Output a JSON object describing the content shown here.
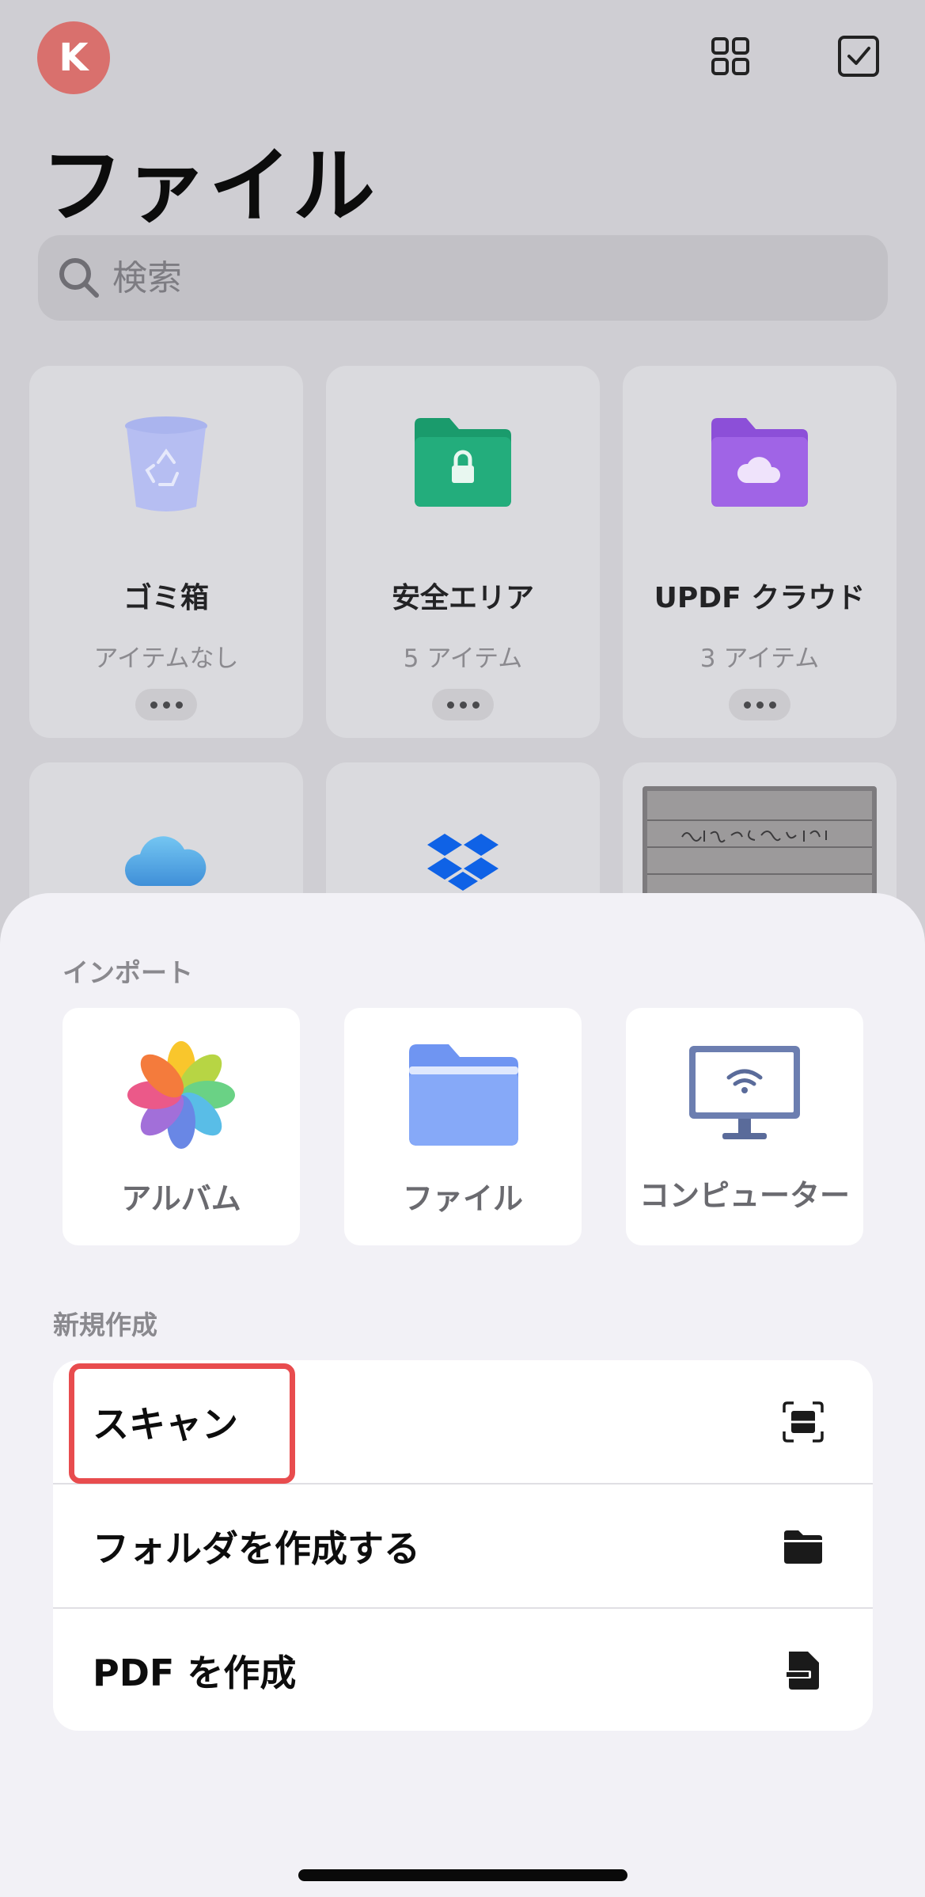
{
  "header": {
    "avatar_letter": "K",
    "title": "ファイル",
    "icons": [
      "grid-view-icon",
      "select-checkbox-icon"
    ]
  },
  "search": {
    "placeholder": "検索"
  },
  "tiles": [
    {
      "name": "ゴミ箱",
      "count": "アイテムなし",
      "icon": "trash-bin-icon"
    },
    {
      "name": "安全エリア",
      "count": "5 アイテム",
      "icon": "locked-folder-icon"
    },
    {
      "name": "UPDF クラウド",
      "count": "3 アイテム",
      "icon": "cloud-folder-icon"
    }
  ],
  "tiles_row2_icons": [
    "icloud-icon",
    "dropbox-icon",
    "document-thumbnail"
  ],
  "sheet": {
    "import_label": "インポート",
    "import_items": [
      {
        "label": "アルバム",
        "icon": "photos-icon"
      },
      {
        "label": "ファイル",
        "icon": "files-folder-icon"
      },
      {
        "label": "コンピューター",
        "icon": "computer-wifi-icon"
      }
    ],
    "create_label": "新規作成",
    "create_items": [
      {
        "label": "スキャン",
        "icon": "scan-icon"
      },
      {
        "label": "フォルダを作成する",
        "icon": "folder-icon"
      },
      {
        "label": "PDF を作成",
        "icon": "pdf-file-icon"
      }
    ]
  },
  "colors": {
    "avatar": "#d9706d",
    "highlight": "#e84c4e",
    "secure_folder": "#1fa675",
    "cloud_folder": "#9b5fe0",
    "files_folder": "#7ea4f8"
  }
}
